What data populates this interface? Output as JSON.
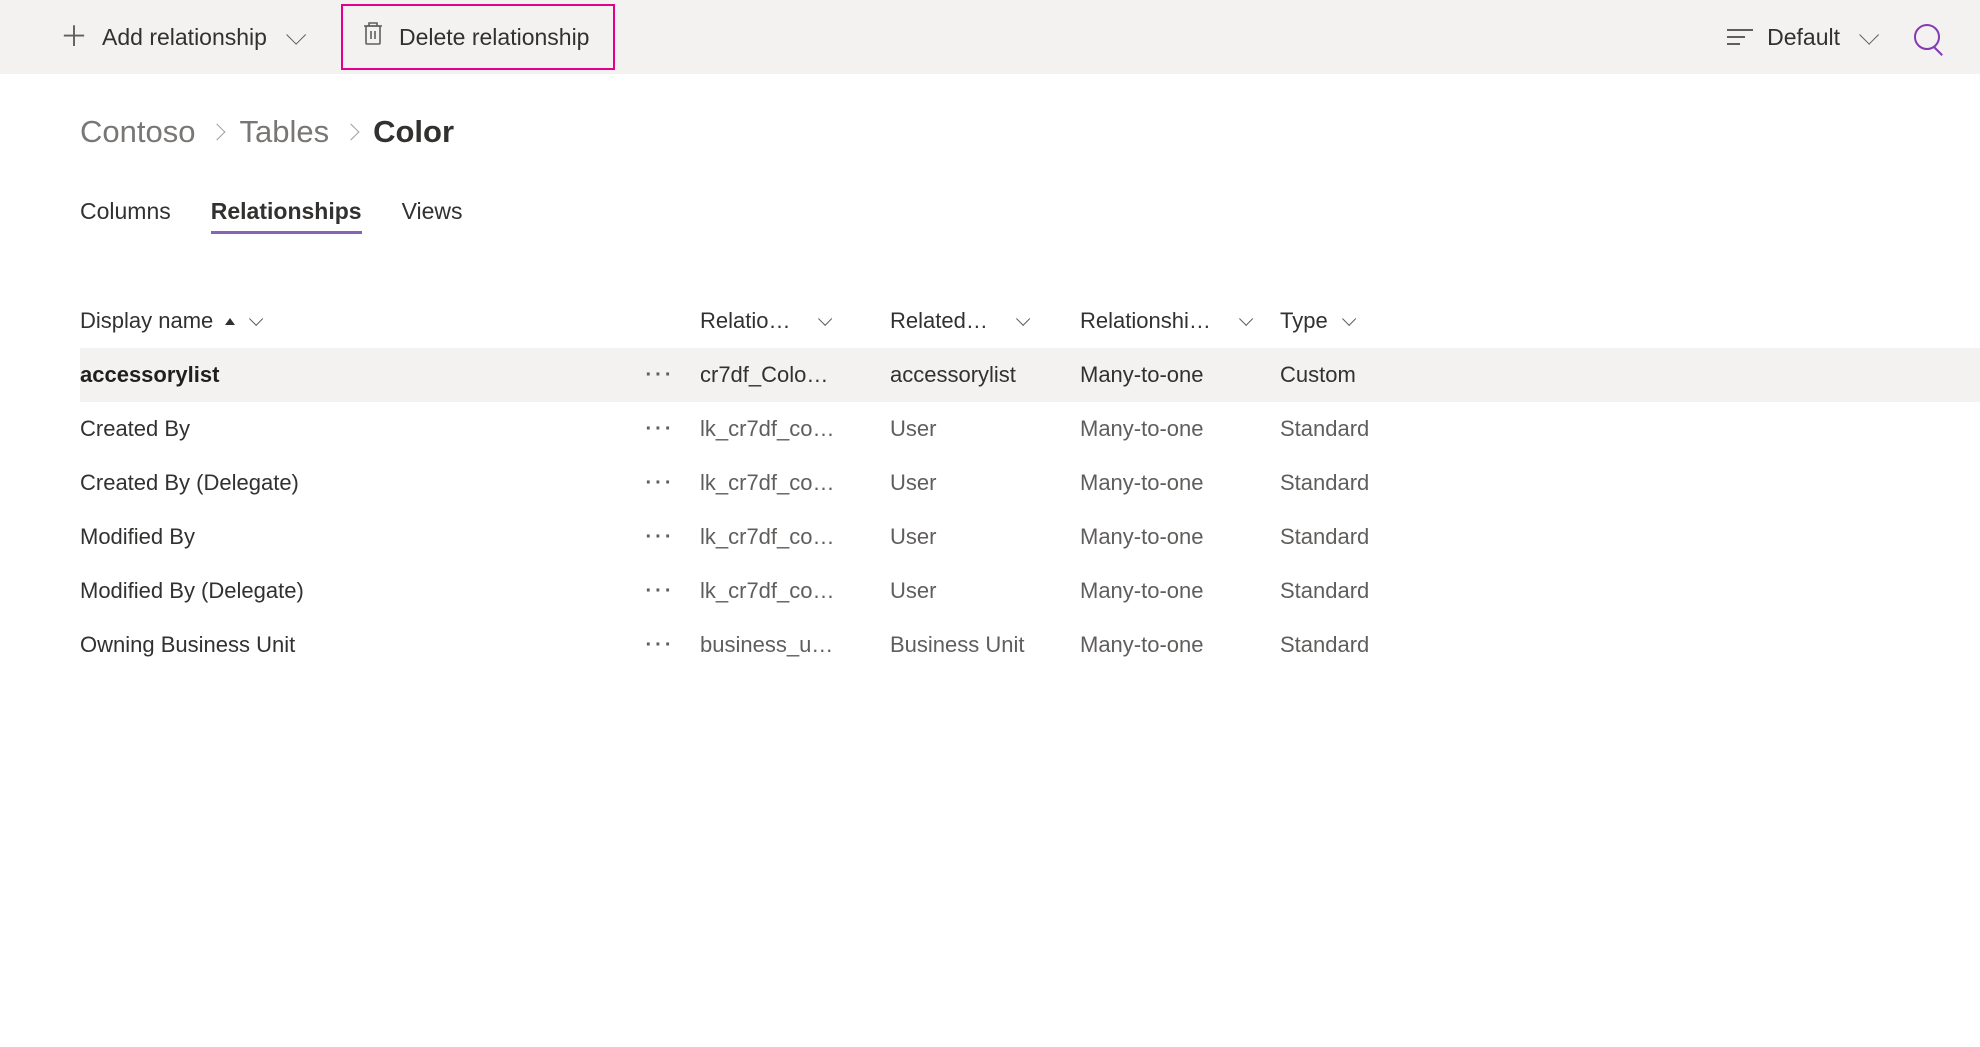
{
  "toolbar": {
    "add_label": "Add relationship",
    "delete_label": "Delete relationship",
    "view_label": "Default"
  },
  "breadcrumb": {
    "root": "Contoso",
    "section": "Tables",
    "current": "Color"
  },
  "tabs": {
    "columns": "Columns",
    "relationships": "Relationships",
    "views": "Views"
  },
  "grid": {
    "headers": {
      "display_name": "Display name",
      "relation": "Relatio…",
      "related": "Related…",
      "relationship": "Relationshi…",
      "type": "Type"
    },
    "rows": [
      {
        "name": "accessorylist",
        "relation": "cr7df_Colo…",
        "related": "accessorylist",
        "relationship": "Many-to-one",
        "type": "Custom",
        "selected": true
      },
      {
        "name": "Created By",
        "relation": "lk_cr7df_co…",
        "related": "User",
        "relationship": "Many-to-one",
        "type": "Standard",
        "selected": false
      },
      {
        "name": "Created By (Delegate)",
        "relation": "lk_cr7df_co…",
        "related": "User",
        "relationship": "Many-to-one",
        "type": "Standard",
        "selected": false
      },
      {
        "name": "Modified By",
        "relation": "lk_cr7df_co…",
        "related": "User",
        "relationship": "Many-to-one",
        "type": "Standard",
        "selected": false
      },
      {
        "name": "Modified By (Delegate)",
        "relation": "lk_cr7df_co…",
        "related": "User",
        "relationship": "Many-to-one",
        "type": "Standard",
        "selected": false
      },
      {
        "name": "Owning Business Unit",
        "relation": "business_u…",
        "related": "Business Unit",
        "relationship": "Many-to-one",
        "type": "Standard",
        "selected": false
      }
    ]
  }
}
